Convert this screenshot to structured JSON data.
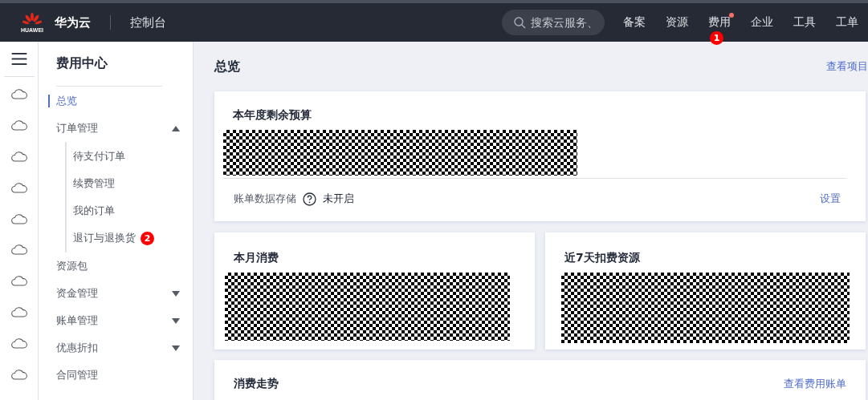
{
  "header": {
    "logo_text": "HUAWEI",
    "brand": "华为云",
    "console": "控制台",
    "search": {
      "placeholder": "搜索云服务、"
    },
    "nav": [
      {
        "label": "备案",
        "dot": false
      },
      {
        "label": "资源",
        "dot": false
      },
      {
        "label": "费用",
        "dot": true,
        "badge": "1"
      },
      {
        "label": "企业",
        "dot": false
      },
      {
        "label": "工具",
        "dot": false
      },
      {
        "label": "工单",
        "dot": false
      }
    ]
  },
  "sidebar": {
    "title": "费用中心",
    "items": [
      {
        "label": "总览",
        "selected": true
      },
      {
        "label": "订单管理",
        "selected": false,
        "expanded": true,
        "children": [
          {
            "label": "待支付订单",
            "selected": false
          },
          {
            "label": "续费管理",
            "selected": false
          },
          {
            "label": "我的订单",
            "selected": false
          },
          {
            "label": "退订与退换货",
            "selected": false,
            "badge": "2"
          }
        ]
      },
      {
        "label": "资源包",
        "selected": false
      },
      {
        "label": "资金管理",
        "selected": false,
        "expanded": false
      },
      {
        "label": "账单管理",
        "selected": false,
        "expanded": false
      },
      {
        "label": "优惠折扣",
        "selected": false,
        "expanded": false
      },
      {
        "label": "合同管理",
        "selected": false
      }
    ]
  },
  "main": {
    "title": "总览",
    "link": "查看项目",
    "budget": {
      "title": "本年度剩余预算",
      "footer_label": "账单数据存储",
      "status": "未开启",
      "action": "设置"
    },
    "cards": [
      {
        "title": "本月消费"
      },
      {
        "title": "近7天扣费资源"
      }
    ],
    "trend": {
      "title": "消费走势",
      "link": "查看费用账单"
    }
  }
}
